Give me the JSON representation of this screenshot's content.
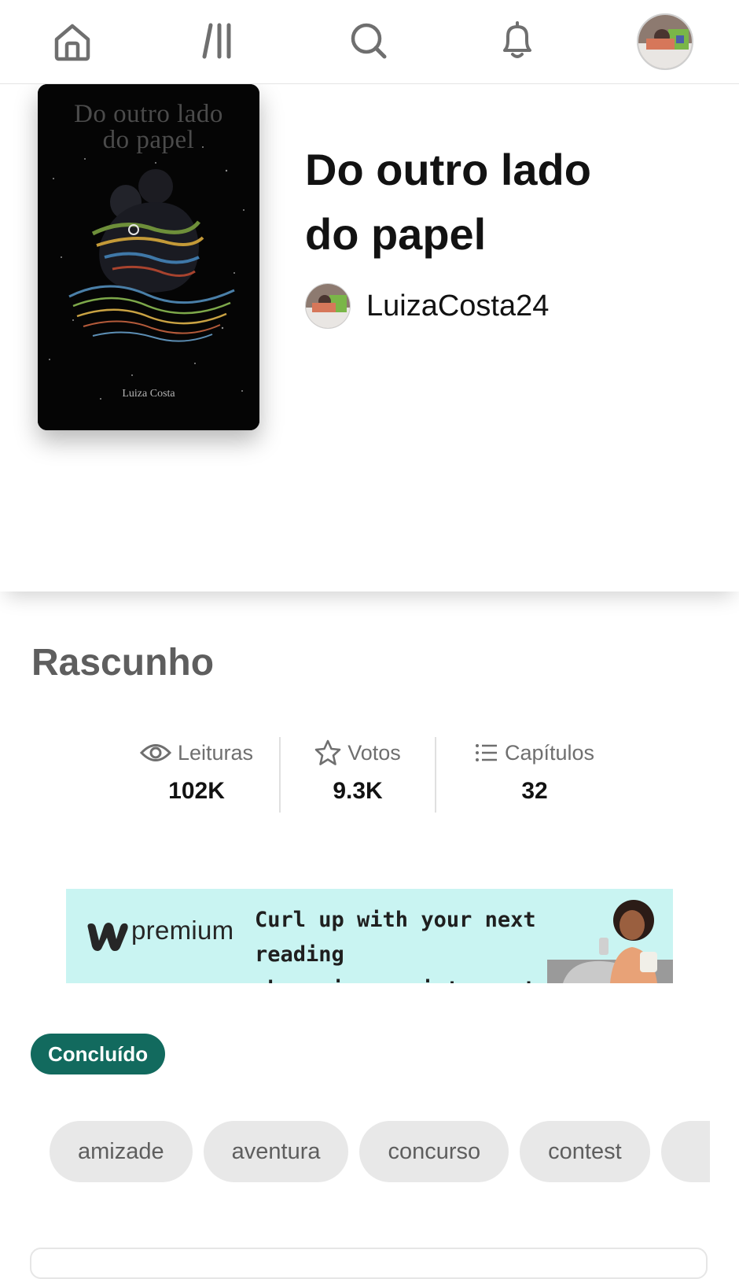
{
  "nav": {
    "items": [
      {
        "name": "home",
        "icon": "home-icon"
      },
      {
        "name": "library",
        "icon": "library-icon"
      },
      {
        "name": "search",
        "icon": "search-icon"
      },
      {
        "name": "notifications",
        "icon": "bell-icon"
      },
      {
        "name": "profile",
        "icon": "avatar"
      }
    ]
  },
  "story": {
    "cover_title_line1": "Do outro lado",
    "cover_title_line2": "do papel",
    "cover_author": "Luiza Costa",
    "title": "Do outro lado do papel",
    "author": "LuizaCosta24"
  },
  "section": {
    "title": "Rascunho"
  },
  "stats": {
    "reads_label": "Leituras",
    "reads_value": "102K",
    "votes_label": "Votos",
    "votes_value": "9.3K",
    "parts_label": "Capítulos",
    "parts_value": "32"
  },
  "banner": {
    "logo_word": "premium",
    "line1": "Curl up with your next reading",
    "line2": "obsession, uninterrupted."
  },
  "status": "Concluído",
  "tags": [
    "amizade",
    "aventura",
    "concurso",
    "contest"
  ],
  "colors": {
    "status_badge": "#126a5e",
    "banner_bg": "#c9f4f2",
    "tag_bg": "#e8e8e8"
  }
}
